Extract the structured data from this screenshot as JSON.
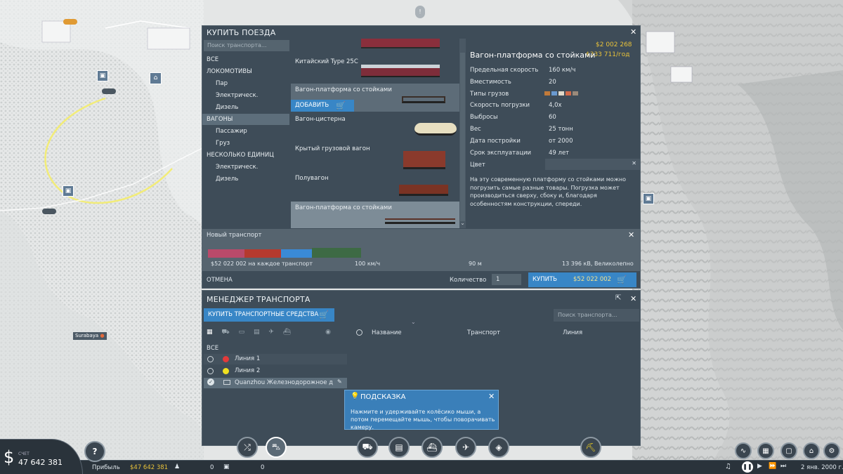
{
  "map": {
    "city_label": "Surabaya"
  },
  "buy_train": {
    "title": "КУПИТЬ ПОЕЗДА",
    "search_placeholder": "Поиск транспорта...",
    "categories": [
      {
        "label": "ВСЕ",
        "sub": false,
        "selected": false
      },
      {
        "label": "ЛОКОМОТИВЫ",
        "sub": false,
        "selected": false
      },
      {
        "label": "Пар",
        "sub": true,
        "selected": false
      },
      {
        "label": "Электрическ.",
        "sub": true,
        "selected": false
      },
      {
        "label": "Дизель",
        "sub": true,
        "selected": false
      },
      {
        "label": "ВАГОНЫ",
        "sub": false,
        "selected": true
      },
      {
        "label": "Пассажир",
        "sub": true,
        "selected": false
      },
      {
        "label": "Груз",
        "sub": true,
        "selected": false
      },
      {
        "label": "НЕСКОЛЬКО ЕДИНИЦ",
        "sub": false,
        "selected": false
      },
      {
        "label": "Электрическ.",
        "sub": true,
        "selected": false
      },
      {
        "label": "Дизель",
        "sub": true,
        "selected": false
      }
    ],
    "vehicles": [
      {
        "name": "Китайский Type 25C",
        "color": "#8a2f3c"
      },
      {
        "name": "Вагон-платформа со стойками",
        "color": "#3a2e28"
      },
      {
        "name": "Вагон-цистерна",
        "color": "#e7dfc1"
      },
      {
        "name": "Крытый грузовой вагон",
        "color": "#8a3a2c"
      },
      {
        "name": "Полувагон",
        "color": "#7a3324"
      },
      {
        "name": "Вагон-платформа со стойками",
        "color": "#5a3228"
      }
    ],
    "add_label": "ДОБАВИТЬ",
    "detail": {
      "name": "Вагон-платформа со стойками",
      "price": "$2 002 268",
      "yearly": "$333 711/год",
      "stats": [
        {
          "k": "Предельная скорость",
          "v": "160 км/ч"
        },
        {
          "k": "Вместимость",
          "v": "20"
        },
        {
          "k": "Типы грузов",
          "v": ""
        },
        {
          "k": "Скорость погрузки",
          "v": "4,0x"
        },
        {
          "k": "Выбросы",
          "v": "60"
        },
        {
          "k": "Вес",
          "v": "25 тонн"
        },
        {
          "k": "Дата постройки",
          "v": "от 2000"
        },
        {
          "k": "Срок эксплуатации",
          "v": "49 лет"
        }
      ],
      "color_label": "Цвет",
      "description": "На эту современную платформу со стойками можно погрузить самые разные товары. Погрузка может производиться сверху, сбоку и, благодаря особенностям конструкции, спереди."
    },
    "new_transport": {
      "title": "Новый транспорт",
      "cost": "$52 022 002 на каждое транспорт",
      "speed": "100 км/ч",
      "length": "90 м",
      "power": "13 396 кВ, Великолепно"
    },
    "cancel": "ОТМЕНА",
    "quantity_label": "Количество",
    "quantity": "1",
    "buy_label": "КУПИТЬ",
    "buy_price": "$52 022 002"
  },
  "manager": {
    "title": "МЕНЕДЖЕР ТРАНСПОРТА",
    "buy_button": "КУПИТЬ ТРАНСПОРТНЫЕ СРЕДСТВА",
    "search_placeholder": "Поиск транспорта...",
    "col_name": "Название",
    "col_vehicle": "Транспорт",
    "col_line": "Линия",
    "all_label": "ВСЕ",
    "lines": [
      {
        "name": "Линия 1",
        "color": "#e23a3a"
      },
      {
        "name": "Линия 2",
        "color": "#f0e020"
      }
    ],
    "depot": "Quanzhou Железнодорожное деп"
  },
  "tooltip": {
    "title": "ПОДСКАЗКА",
    "text": "Нажмите и удерживайте колёсико мыши, а потом перемещайте мышь, чтобы поворачивать камеру."
  },
  "bottom": {
    "account_label": "СЧЕТ",
    "balance": "47 642 381",
    "profit_label": "Прибыль",
    "profit": "$47 642 381",
    "count1": "0",
    "count2": "0",
    "date": "2 янв. 2000 г.",
    "help": "?"
  },
  "colors": {
    "panel": "#3e4c58",
    "accent": "#3886c6",
    "price": "#e8c23a"
  }
}
